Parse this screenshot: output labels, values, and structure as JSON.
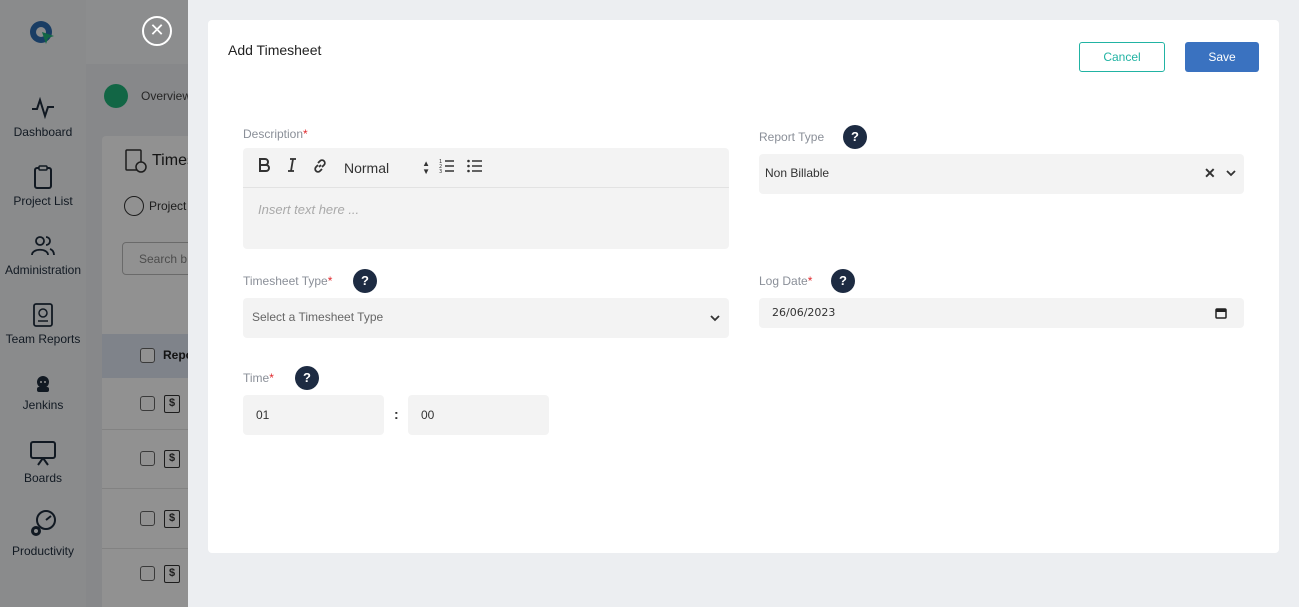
{
  "sidebar": {
    "items": [
      {
        "label": "Dashboard",
        "icon": "activity-icon"
      },
      {
        "label": "Project List",
        "icon": "clipboard-icon"
      },
      {
        "label": "Administration",
        "icon": "users-icon"
      },
      {
        "label": "Team Reports",
        "icon": "report-icon"
      },
      {
        "label": "Jenkins",
        "icon": "jenkins-icon"
      },
      {
        "label": "Boards",
        "icon": "board-icon"
      },
      {
        "label": "Productivity",
        "icon": "productivity-icon"
      }
    ]
  },
  "background": {
    "breadcrumb": "Overview",
    "card_title": "Times",
    "tab": "Project",
    "search_placeholder": "Search b",
    "table_header": "Repo"
  },
  "modal": {
    "title": "Add Timesheet",
    "cancel_label": "Cancel",
    "save_label": "Save",
    "description": {
      "label": "Description",
      "required_mark": "*",
      "format_value": "Normal",
      "placeholder": "Insert text here ..."
    },
    "report_type": {
      "label": "Report Type",
      "value": "Non Billable"
    },
    "timesheet_type": {
      "label": "Timesheet Type",
      "required_mark": "*",
      "placeholder": "Select a Timesheet Type"
    },
    "log_date": {
      "label": "Log Date",
      "required_mark": "*",
      "value": "26/06/2023"
    },
    "time": {
      "label": "Time",
      "required_mark": "*",
      "hours": "01",
      "separator": ":",
      "minutes": "00"
    },
    "help_glyph": "?"
  },
  "colors": {
    "primary": "#3a72c0",
    "cancel_accent": "#21b3a3",
    "required": "#e0292d",
    "help_bg": "#1d2b42"
  }
}
